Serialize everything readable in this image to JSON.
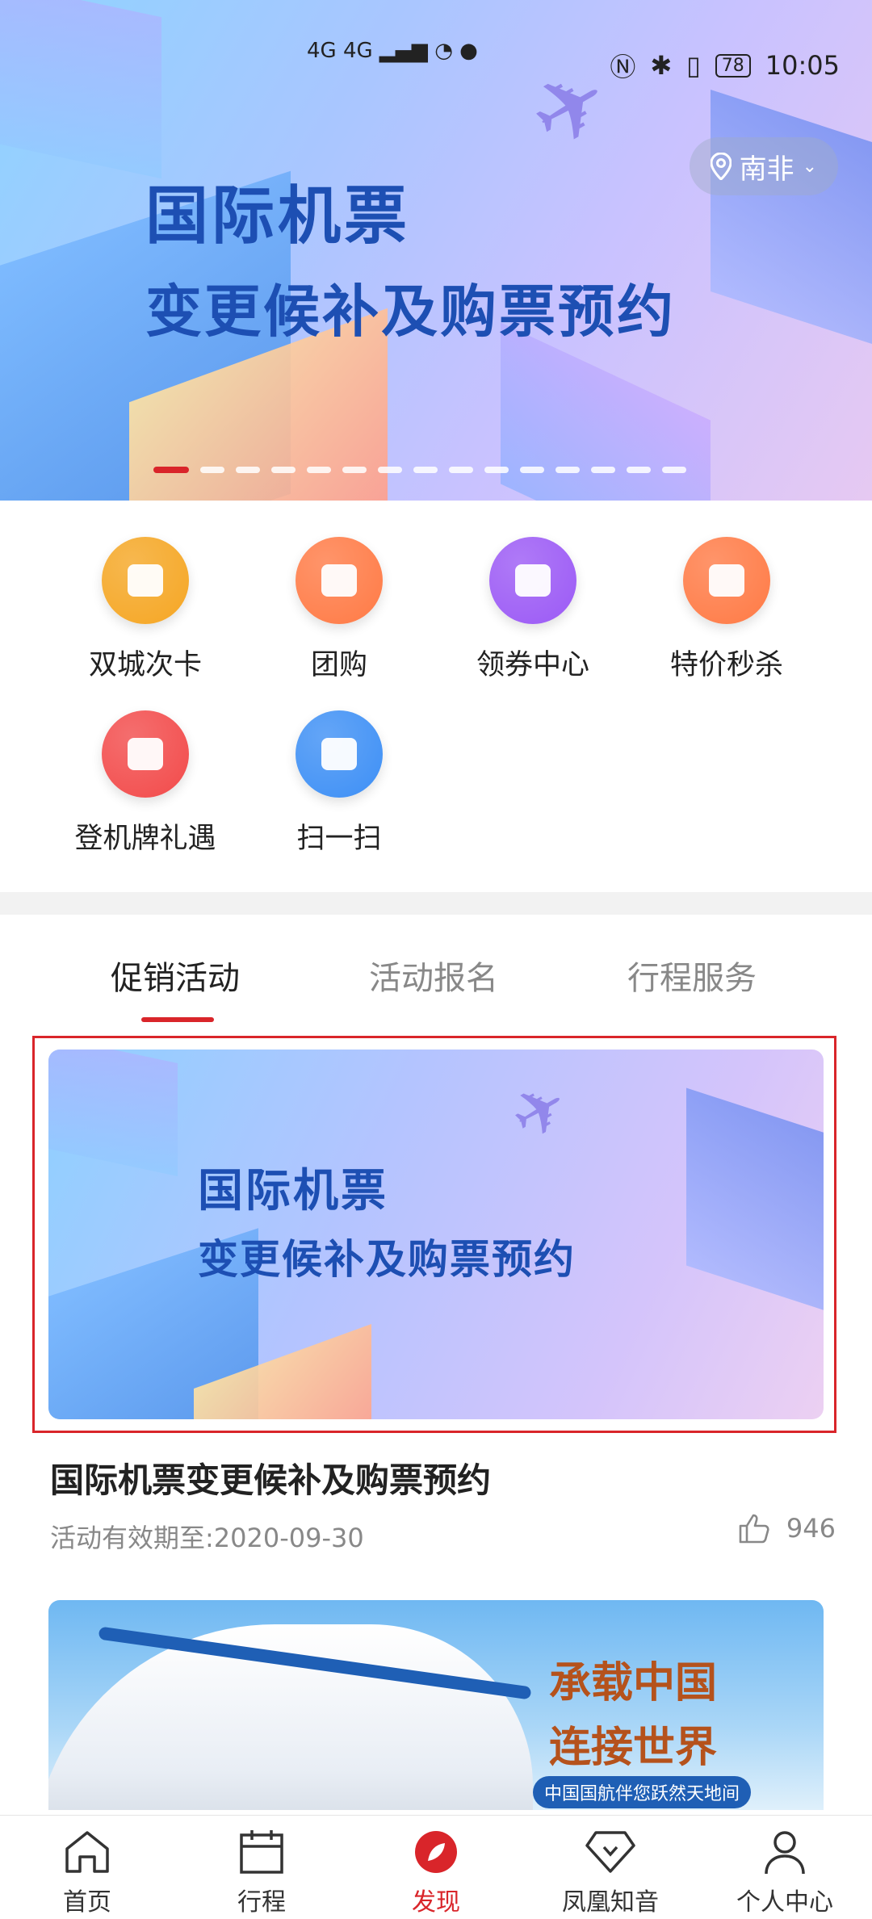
{
  "status_bar": {
    "signal_text": "4G 4G",
    "time": "10:05",
    "battery": "78"
  },
  "hero": {
    "title_line1": "国际机票",
    "title_line2": "变更候补及购票预约",
    "location": "南非",
    "slide_count": 15,
    "active_slide": 0
  },
  "quick_grid": [
    {
      "label": "双城次卡",
      "icon": "city-card-icon",
      "color": "#f5a623"
    },
    {
      "label": "团购",
      "icon": "shopping-bag-icon",
      "color": "#ff7a45"
    },
    {
      "label": "领券中心",
      "icon": "coupon-icon",
      "color": "#9b59f5"
    },
    {
      "label": "特价秒杀",
      "icon": "alarm-clock-icon",
      "color": "#ff7a45"
    },
    {
      "label": "登机牌礼遇",
      "icon": "boarding-pass-icon",
      "color": "#f24a4a"
    },
    {
      "label": "扫一扫",
      "icon": "scan-icon",
      "color": "#3d8ff5"
    }
  ],
  "tabs": [
    {
      "label": "促销活动",
      "active": true
    },
    {
      "label": "活动报名",
      "active": false
    },
    {
      "label": "行程服务",
      "active": false
    }
  ],
  "promo": {
    "banner_line1": "国际机票",
    "banner_line2": "变更候补及购票预约",
    "title": "国际机票变更候补及购票预约",
    "validity": "活动有效期至:2020-09-30",
    "likes": "946"
  },
  "promo2": {
    "line1": "承载中国",
    "line2": "连接世界",
    "tagline": "中国国航伴您跃然天地间"
  },
  "bottom_nav": [
    {
      "label": "首页",
      "icon": "home-icon",
      "active": false
    },
    {
      "label": "行程",
      "icon": "calendar-icon",
      "active": false
    },
    {
      "label": "发现",
      "icon": "compass-icon",
      "active": true
    },
    {
      "label": "凤凰知音",
      "icon": "diamond-icon",
      "active": false
    },
    {
      "label": "个人中心",
      "icon": "user-icon",
      "active": false
    }
  ],
  "colors": {
    "accent": "#d9252a",
    "banner_text": "#1d4fb3"
  }
}
